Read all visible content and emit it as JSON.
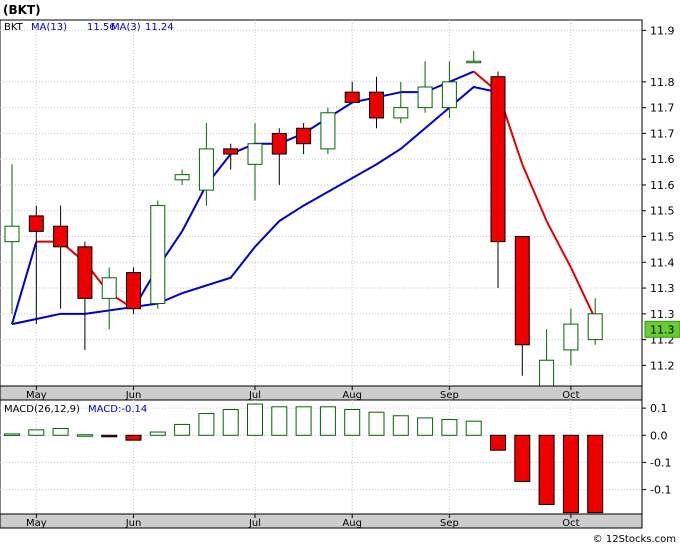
{
  "header": {
    "ticker": "(BKT)",
    "legend": [
      {
        "label": "BKT",
        "color": "#000000"
      },
      {
        "label": "MA(13)",
        "value": "11.56",
        "color": "#0000cc"
      },
      {
        "label": "MA(3)",
        "value": "11.24",
        "color": "#0000cc"
      }
    ]
  },
  "macd_header": {
    "label": "MACD(26,12,9)",
    "value_label": "MACD:-0.14"
  },
  "footer": {
    "copyright": "© 12Stocks.com"
  },
  "colors": {
    "up_fill": "#ffffff",
    "up_stroke": "#006600",
    "down_fill": "#ee0000",
    "ma_blue": "#0000cc",
    "ma_red": "#e00000",
    "axis_bg": "#cccccc",
    "grid": "#c8c8c8",
    "last_price_box": "#66cc33"
  },
  "chart_data": [
    {
      "type": "candlestick",
      "title": "",
      "ticker": "BKT",
      "x_axis_labels": [
        "May",
        "Jun",
        "Jul",
        "Aug",
        "Sep",
        "Oct"
      ],
      "y_ticks": [
        "11.9",
        "11.8",
        "11.7",
        "11.7",
        "11.6",
        "11.6",
        "11.5",
        "11.5",
        "11.4",
        "11.3",
        "11.3",
        "11.2",
        "11.2"
      ],
      "y_tick_values": [
        11.9,
        11.8,
        11.75,
        11.7,
        11.65,
        11.6,
        11.55,
        11.5,
        11.45,
        11.4,
        11.35,
        11.3,
        11.25
      ],
      "ylim": [
        11.21,
        11.92
      ],
      "last_price_label": "11.3",
      "last_price": 11.32,
      "candles": [
        {
          "x": "Apr-25",
          "open": 11.49,
          "high": 11.64,
          "low": 11.35,
          "close": 11.52
        },
        {
          "x": "May-02",
          "open": 11.54,
          "high": 11.56,
          "low": 11.33,
          "close": 11.51
        },
        {
          "x": "May-09",
          "open": 11.52,
          "high": 11.56,
          "low": 11.36,
          "close": 11.48
        },
        {
          "x": "May-16",
          "open": 11.48,
          "high": 11.49,
          "low": 11.28,
          "close": 11.38
        },
        {
          "x": "May-23",
          "open": 11.38,
          "high": 11.44,
          "low": 11.32,
          "close": 11.42
        },
        {
          "x": "May-30",
          "open": 11.43,
          "high": 11.44,
          "low": 11.35,
          "close": 11.36
        },
        {
          "x": "Jun-06",
          "open": 11.37,
          "high": 11.57,
          "low": 11.36,
          "close": 11.56
        },
        {
          "x": "Jun-13",
          "open": 11.61,
          "high": 11.63,
          "low": 11.6,
          "close": 11.62
        },
        {
          "x": "Jun-20",
          "open": 11.59,
          "high": 11.72,
          "low": 11.56,
          "close": 11.67
        },
        {
          "x": "Jun-27",
          "open": 11.67,
          "high": 11.68,
          "low": 11.63,
          "close": 11.66
        },
        {
          "x": "Jul-04",
          "open": 11.64,
          "high": 11.72,
          "low": 11.57,
          "close": 11.68
        },
        {
          "x": "Jul-11",
          "open": 11.7,
          "high": 11.71,
          "low": 11.6,
          "close": 11.66
        },
        {
          "x": "Jul-18",
          "open": 11.71,
          "high": 11.72,
          "low": 11.66,
          "close": 11.68
        },
        {
          "x": "Jul-25",
          "open": 11.67,
          "high": 11.75,
          "low": 11.66,
          "close": 11.74
        },
        {
          "x": "Aug-01",
          "open": 11.78,
          "high": 11.8,
          "low": 11.76,
          "close": 11.76
        },
        {
          "x": "Aug-08",
          "open": 11.78,
          "high": 11.81,
          "low": 11.71,
          "close": 11.73
        },
        {
          "x": "Aug-15",
          "open": 11.73,
          "high": 11.8,
          "low": 11.72,
          "close": 11.75
        },
        {
          "x": "Aug-22",
          "open": 11.75,
          "high": 11.84,
          "low": 11.74,
          "close": 11.79
        },
        {
          "x": "Aug-29",
          "open": 11.75,
          "high": 11.84,
          "low": 11.73,
          "close": 11.8
        },
        {
          "x": "Sep-05",
          "open": 11.84,
          "high": 11.86,
          "low": 11.84,
          "close": 11.84
        },
        {
          "x": "Sep-12",
          "open": 11.81,
          "high": 11.82,
          "low": 11.4,
          "close": 11.49
        },
        {
          "x": "Sep-19",
          "open": 11.5,
          "high": 11.5,
          "low": 11.23,
          "close": 11.29
        },
        {
          "x": "Sep-26",
          "open": 11.2,
          "high": 11.32,
          "low": 11.2,
          "close": 11.26
        },
        {
          "x": "Oct-03",
          "open": 11.28,
          "high": 11.36,
          "low": 11.25,
          "close": 11.33
        },
        {
          "x": "Oct-10",
          "open": 11.3,
          "high": 11.38,
          "low": 11.29,
          "close": 11.35
        }
      ],
      "series": [
        {
          "name": "MA(13)",
          "color": "#0000cc",
          "points": [
            [
              0,
              11.33
            ],
            [
              1,
              11.34
            ],
            [
              2,
              11.35
            ],
            [
              3,
              11.35
            ],
            [
              6,
              11.37
            ],
            [
              7,
              11.39
            ],
            [
              9,
              11.42
            ],
            [
              10,
              11.48
            ],
            [
              11,
              11.53
            ],
            [
              12,
              11.56
            ],
            [
              15,
              11.64
            ],
            [
              16,
              11.67
            ],
            [
              18,
              11.75
            ],
            [
              19,
              11.79
            ],
            [
              20,
              11.78
            ]
          ]
        },
        {
          "name": "MA(3)",
          "color": "#0000cc",
          "segments_color": [
            "#0000cc",
            "#e00000"
          ],
          "points": [
            [
              0,
              11.33,
              "blue"
            ],
            [
              1,
              11.49,
              "blue"
            ],
            [
              2,
              11.49,
              "red"
            ],
            [
              3,
              11.45,
              "red"
            ],
            [
              4,
              11.39,
              "red"
            ],
            [
              5,
              11.36,
              "red"
            ],
            [
              6,
              11.44,
              "blue"
            ],
            [
              7,
              11.51,
              "blue"
            ],
            [
              8,
              11.6,
              "blue"
            ],
            [
              9,
              11.66,
              "blue"
            ],
            [
              10,
              11.68,
              "blue"
            ],
            [
              11,
              11.68,
              "blue"
            ],
            [
              12,
              11.7,
              "blue"
            ],
            [
              13,
              11.73,
              "blue"
            ],
            [
              14,
              11.76,
              "blue"
            ],
            [
              15,
              11.77,
              "blue"
            ],
            [
              16,
              11.78,
              "blue"
            ],
            [
              17,
              11.78,
              "blue"
            ],
            [
              18,
              11.8,
              "blue"
            ],
            [
              19,
              11.82,
              "blue"
            ],
            [
              20,
              11.78,
              "red"
            ],
            [
              21,
              11.64,
              "red"
            ],
            [
              22,
              11.53,
              "red"
            ],
            [
              23,
              11.44,
              "red"
            ],
            [
              24,
              11.34,
              "red"
            ]
          ]
        }
      ]
    },
    {
      "type": "bar",
      "title": "MACD(26,12,9)",
      "y_ticks": [
        "0.1",
        "0.0",
        "-0.1",
        "-0.1"
      ],
      "y_tick_values": [
        0.1,
        0.0,
        -0.1,
        -0.2
      ],
      "ylim": [
        -0.29,
        0.13
      ],
      "values": [
        0.005,
        0.02,
        0.025,
        0.002,
        -0.002,
        -0.018,
        0.012,
        0.04,
        0.08,
        0.095,
        0.115,
        0.105,
        0.105,
        0.105,
        0.095,
        0.085,
        0.072,
        0.064,
        0.058,
        0.052,
        -0.055,
        -0.17,
        -0.255,
        -0.285,
        -0.285
      ]
    }
  ]
}
